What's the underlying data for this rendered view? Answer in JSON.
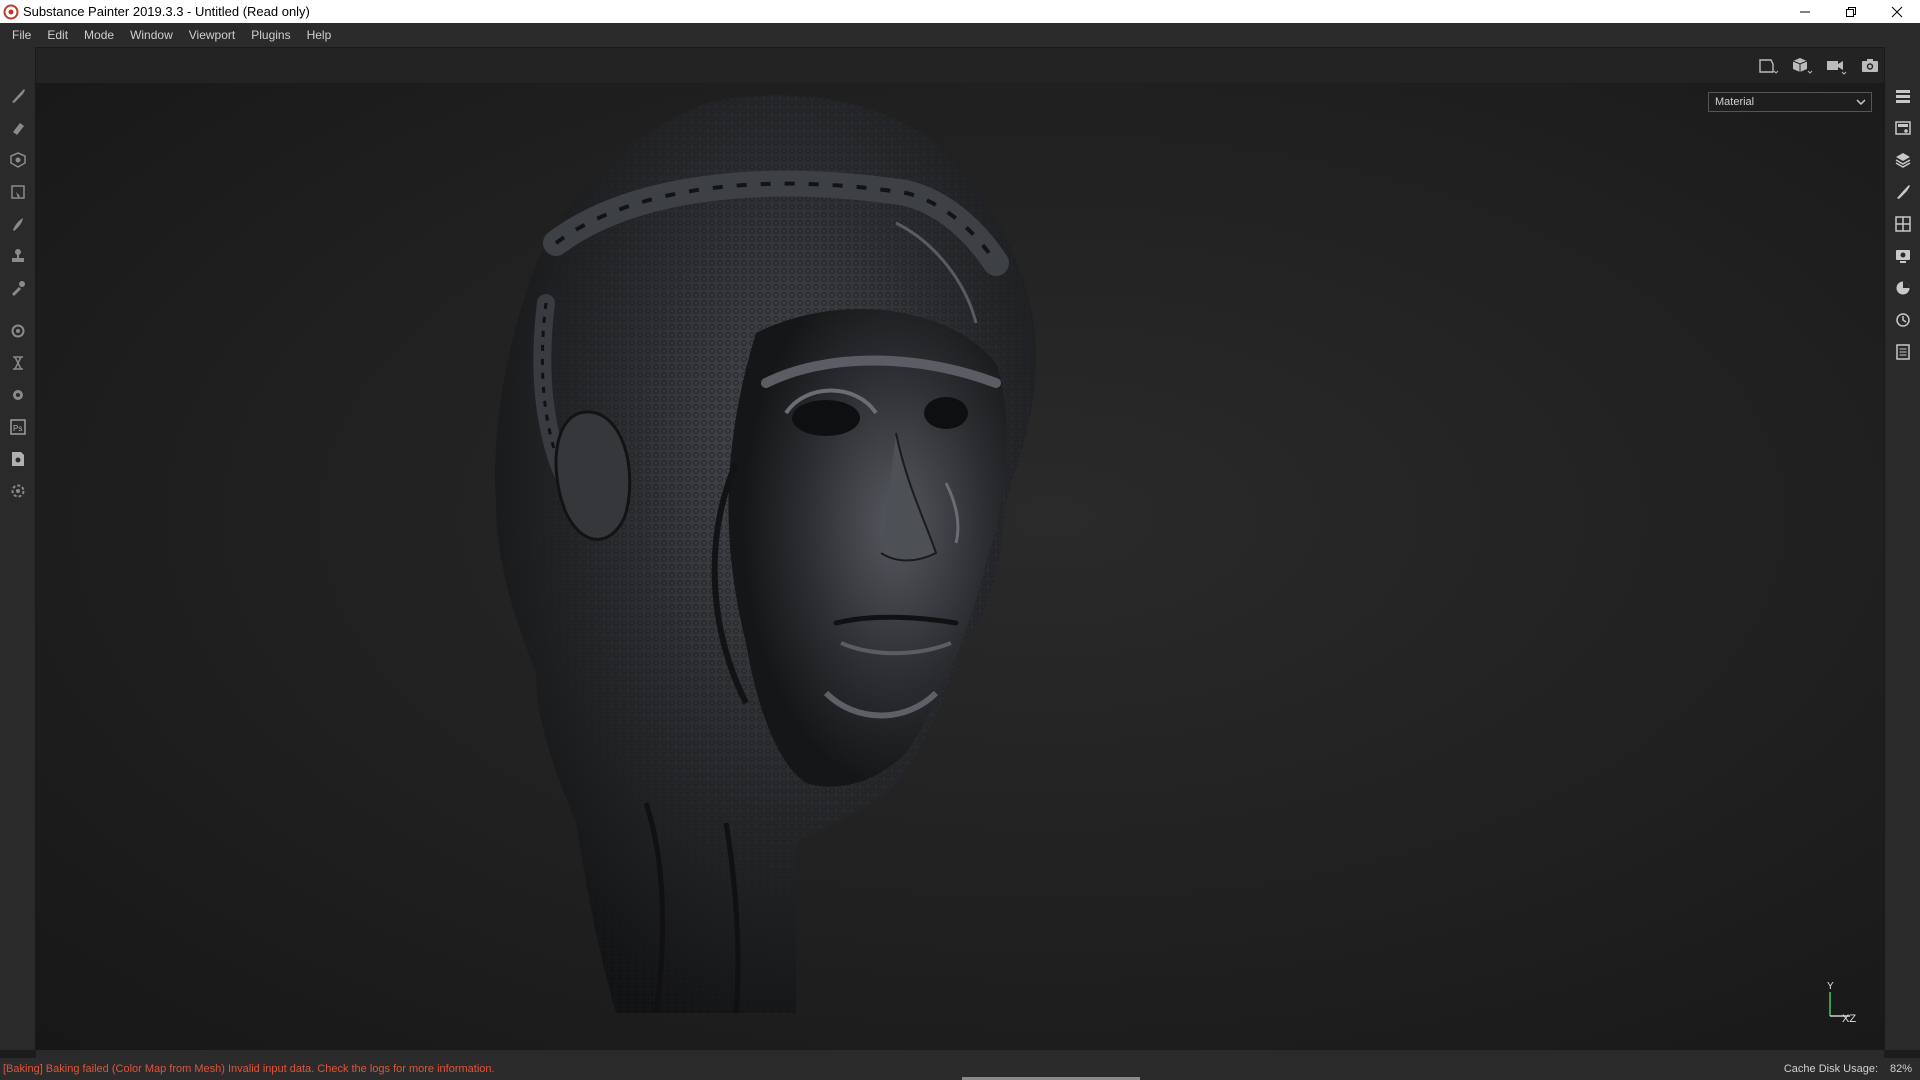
{
  "window": {
    "title": "Substance Painter 2019.3.3 - Untitled (Read only)"
  },
  "menu": {
    "items": [
      "File",
      "Edit",
      "Mode",
      "Window",
      "Viewport",
      "Plugins",
      "Help"
    ]
  },
  "viewport": {
    "display_mode": "Material",
    "axis_labels": {
      "y": "Y",
      "xz": "XZ"
    }
  },
  "left_tools": [
    "paint-brush-icon",
    "eraser-icon",
    "projection-icon",
    "polygon-fill-icon",
    "smudge-icon",
    "clone-stamp-icon",
    "color-picker-icon",
    "bake-settings-icon",
    "display-settings-icon",
    "shader-settings-icon",
    "photoshop-export-icon",
    "document-icon",
    "plugin-settings-icon"
  ],
  "right_tools": [
    "texture-set-list-icon",
    "texture-set-settings-icon",
    "layers-icon",
    "properties-icon",
    "shelf-icon",
    "display-icon",
    "shader-icon",
    "history-icon",
    "log-icon"
  ],
  "status": {
    "message": "[Baking] Baking failed (Color Map from Mesh) Invalid input data. Check the logs for more information.",
    "cache_label": "Cache Disk Usage:",
    "cache_value": "82%"
  },
  "colors": {
    "error": "#e0533a",
    "background": "#1c1c1c"
  }
}
